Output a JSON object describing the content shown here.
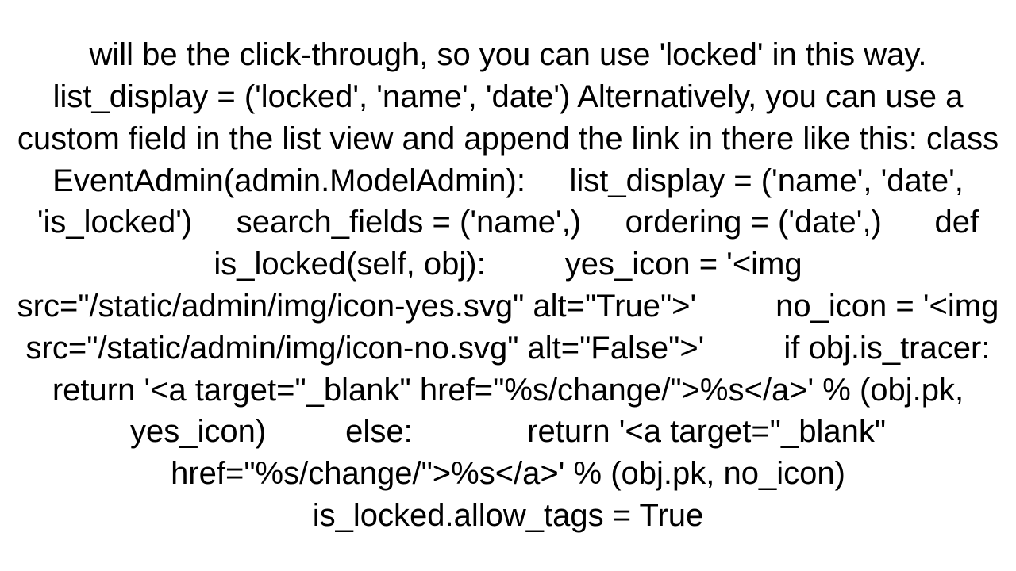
{
  "document": {
    "body_text": "will be the click-through, so you can use 'locked' in this way. list_display = ('locked', 'name', 'date') Alternatively, you can use a custom field in the list view and append the link in there like this: class EventAdmin(admin.ModelAdmin):     list_display = ('name', 'date', 'is_locked')     search_fields = ('name',)     ordering = ('date',)      def is_locked(self, obj):         yes_icon = '<img src=\"/static/admin/img/icon-yes.svg\" alt=\"True\">'         no_icon = '<img src=\"/static/admin/img/icon-no.svg\" alt=\"False\">'         if obj.is_tracer:             return '<a target=\"_blank\" href=\"%s/change/\">%s</a>' % (obj.pk, yes_icon)         else:             return '<a target=\"_blank\" href=\"%s/change/\">%s</a>' % (obj.pk, no_icon)     is_locked.allow_tags = True"
  }
}
